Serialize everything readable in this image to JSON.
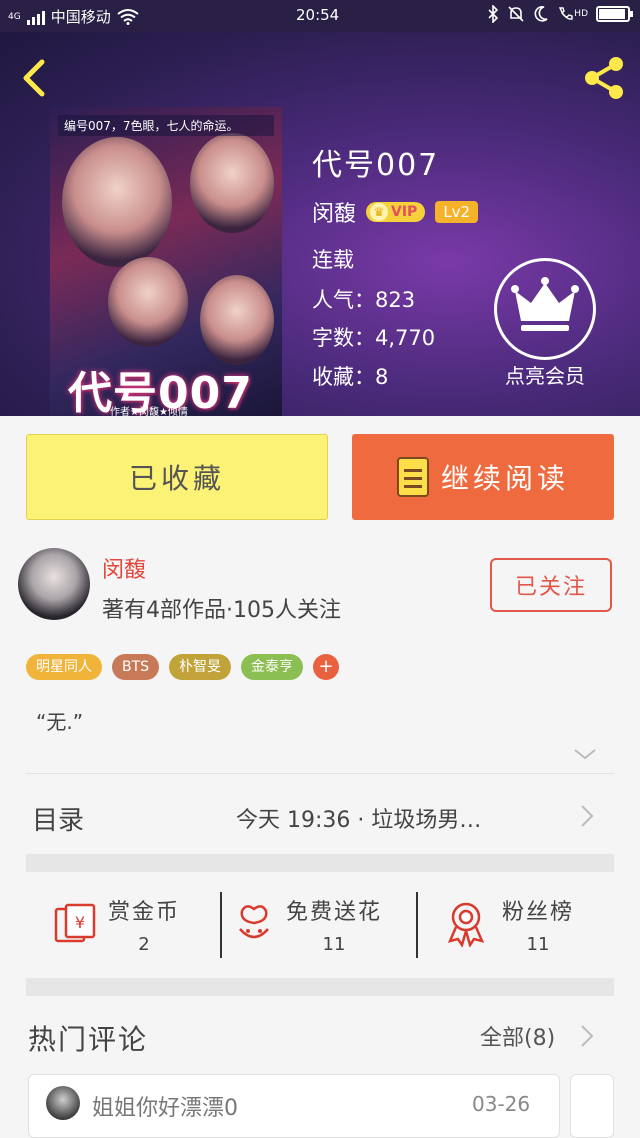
{
  "status_bar": {
    "network": "4G",
    "carrier": "中国移动",
    "time": "20:54",
    "hd": "HD"
  },
  "book": {
    "title": "代号007",
    "author": "闵馥",
    "vip_label": "VIP",
    "level": "Lv2",
    "status": "连载",
    "popularity_label": "人气：",
    "popularity": "823",
    "words_label": "字数：",
    "words": "4,770",
    "favorites_label": "收藏：",
    "favorites": "8",
    "cover": {
      "title": "代号007",
      "topline": "编号007，7色眼，七人的命运。",
      "byline": "作者★闵馥★倾情"
    }
  },
  "member": {
    "label": "点亮会员"
  },
  "actions": {
    "collected_label": "已收藏",
    "continue_label": "继续阅读"
  },
  "author_card": {
    "name": "闵馥",
    "info": "著有4部作品·105人关注",
    "follow_label": "已关注"
  },
  "tags": [
    {
      "label": "明星同人",
      "color": "#f0b43a"
    },
    {
      "label": "BTS",
      "color": "#c87a58"
    },
    {
      "label": "朴智旻",
      "color": "#c2a33a"
    },
    {
      "label": "金泰亨",
      "color": "#8cbf53"
    }
  ],
  "tag_plus": "+",
  "description": "“无.”",
  "toc": {
    "label": "目录",
    "latest": "今天 19:36 · 垃圾场男…"
  },
  "stats": [
    {
      "label": "赏金币",
      "value": "2",
      "icon": "red-envelope-icon"
    },
    {
      "label": "免费送花",
      "value": "11",
      "icon": "flower-icon"
    },
    {
      "label": "粉丝榜",
      "value": "11",
      "icon": "medal-icon"
    }
  ],
  "comments": {
    "label": "热门评论",
    "all_label": "全部(8)",
    "items": [
      {
        "text": "姐姐你好漂漂0",
        "date": "03-26"
      }
    ]
  },
  "colors": {
    "accent_orange": "#ef6a3e",
    "accent_yellow": "#fbf276",
    "accent_red": "#e2574a",
    "icon_yellow": "#ffe84a"
  }
}
